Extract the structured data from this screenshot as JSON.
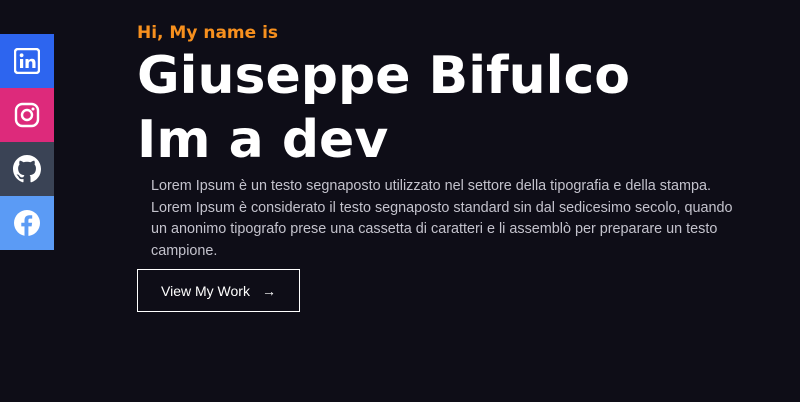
{
  "colors": {
    "background": "#0e0d17",
    "accent": "#f7901e",
    "text": "#ffffff",
    "muted_text": "#c3c2cc",
    "linkedin": "#2d65ef",
    "instagram": "#dd2a7b",
    "github": "#3a4355",
    "facebook": "#5b9bf5"
  },
  "social": [
    {
      "icon": "linkedin-icon"
    },
    {
      "icon": "instagram-icon"
    },
    {
      "icon": "github-icon"
    },
    {
      "icon": "facebook-icon"
    }
  ],
  "hero": {
    "greeting": "Hi, My name is",
    "name": "Giuseppe Bifulco",
    "role": "Im a dev",
    "bio": "Lorem Ipsum è un testo segnaposto utilizzato nel settore della tipografia e della stampa. Lorem Ipsum è considerato il testo segnaposto standard sin dal sedicesimo secolo, quando un anonimo tipografo prese una cassetta di caratteri e li assemblò per preparare un testo campione.",
    "cta_label": "View My Work",
    "cta_icon": "arrow-right-icon",
    "cta_arrow": "→"
  }
}
